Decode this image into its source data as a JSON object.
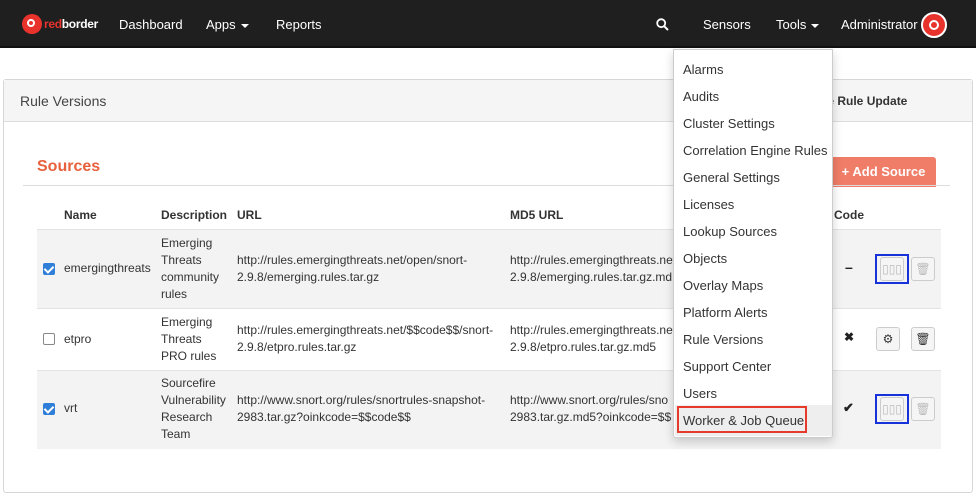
{
  "navbar": {
    "logo_text_red": "red",
    "logo_text_white": "border",
    "links": [
      "Dashboard",
      "Apps",
      "Reports"
    ],
    "right": {
      "sensors": "Sensors",
      "tools": "Tools",
      "user": "Administrator"
    },
    "icons": [
      "search-icon",
      "user-avatar-icon"
    ]
  },
  "panel": {
    "title": "Rule Versions",
    "force_button": "rce Rule Update"
  },
  "sources": {
    "title": "Sources",
    "add_button": "+ Add Source",
    "columns": {
      "name": "Name",
      "description": "Description",
      "url": "URL",
      "md5": "MD5 URL",
      "code": "Code"
    },
    "rows": [
      {
        "checked": true,
        "name": "emergingthreats",
        "description": [
          "Emerging",
          "Threats",
          "community",
          "rules"
        ],
        "url": [
          "http://rules.emergingthreats.net/open/snort-",
          "2.9.8/emerging.rules.tar.gz"
        ],
        "md5": [
          "http://rules.emergingthreats.net/",
          "2.9.8/emerging.rules.tar.gz.md"
        ],
        "code_status": "–"
      },
      {
        "checked": false,
        "name": "etpro",
        "description": [
          "Emerging",
          "Threats",
          "PRO rules"
        ],
        "url": [
          "http://rules.emergingthreats.net/$$code$$/snort-",
          "2.9.8/etpro.rules.tar.gz"
        ],
        "md5": [
          "http://rules.emergingthreats.net/",
          "2.9.8/etpro.rules.tar.gz.md5"
        ],
        "code_status": "✖"
      },
      {
        "checked": true,
        "name": "vrt",
        "description": [
          "Sourcefire",
          "Vulnerability",
          "Research",
          "Team"
        ],
        "url": [
          "http://www.snort.org/rules/snortrules-snapshot-",
          "2983.tar.gz?oinkcode=$$code$$"
        ],
        "md5": [
          "http://www.snort.org/rules/sno",
          "2983.tar.gz.md5?oinkcode=$$"
        ],
        "code_status": "✔"
      }
    ]
  },
  "tools_menu": {
    "items": [
      "Alarms",
      "Audits",
      "Cluster Settings",
      "Correlation Engine Rules",
      "General Settings",
      "Licenses",
      "Lookup Sources",
      "Objects",
      "Overlay Maps",
      "Platform Alerts",
      "Rule Versions",
      "Support Center",
      "Users",
      "Worker & Job Queue"
    ],
    "highlighted": "Worker & Job Queue"
  },
  "colors": {
    "brand": "#e8332d",
    "accent": "#ef7d67",
    "checkbox": "#2f7fd8",
    "highlight_red": "#e63a2a",
    "highlight_blue": "#1632d8"
  }
}
